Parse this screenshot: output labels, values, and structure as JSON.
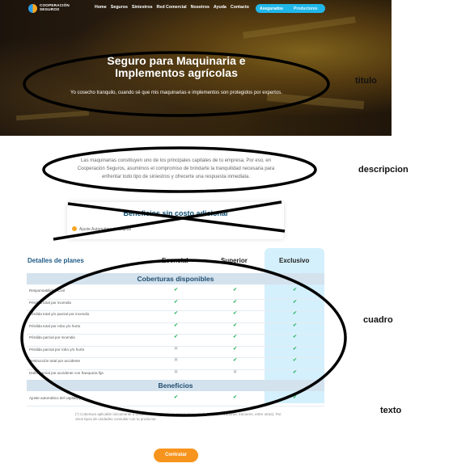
{
  "header": {
    "logo_line1": "COOPERACIÓN",
    "logo_line2": "SEGUROS",
    "nav": [
      "Home",
      "Seguros",
      "Siniestros",
      "Red Comercial",
      "Nosotros",
      "Ayuda",
      "Contacto"
    ],
    "pill_left": "Asegurados",
    "pill_right": "Productores"
  },
  "hero": {
    "title": "Seguro para Maquinaria e Implementos agrícolas",
    "subtitle": "Yo cosecho tranquilo, cuando sé que mis maquinarias e implementos son protegidos por expertos."
  },
  "annotations": {
    "titulo": "titulo",
    "descripcion": "descripcion",
    "cuadro": "cuadro",
    "texto": "texto"
  },
  "description": "Las maquinarias constituyen uno de los principales capitales de tu empresa. Por eso, en Cooperación Seguros, asumimos el compromiso de brindarte la tranquilidad necesaria para enfrentar todo tipo de siniestros y ofrecerte una respuesta inmediata.",
  "benefits_card": {
    "title": "Beneficios sin costo adicional",
    "item": "Ajuste Automático de Capital"
  },
  "plans": {
    "header_label": "Detalles de planes",
    "plan_names": [
      "Esencial",
      "Superior",
      "Exclusivo"
    ],
    "coverage_title": "Coberturas disponibles",
    "coverage_rows": [
      {
        "label": "Responsabilidad Civil",
        "marks": [
          "check",
          "check",
          "check"
        ]
      },
      {
        "label": "Pérdida total por incendio",
        "marks": [
          "check",
          "check",
          "check"
        ]
      },
      {
        "label": "Pérdida total y/o parcial por incendio",
        "marks": [
          "check",
          "check",
          "check"
        ]
      },
      {
        "label": "Pérdida total por robo y/o hurto",
        "marks": [
          "check",
          "check",
          "check"
        ]
      },
      {
        "label": "Pérdida parcial por incendio",
        "marks": [
          "check",
          "check",
          "check"
        ]
      },
      {
        "label": "Pérdida parcial por robo y/o hurto",
        "marks": [
          "cross",
          "check",
          "check"
        ]
      },
      {
        "label": "Destrucción total por accidente",
        "marks": [
          "cross",
          "check",
          "check"
        ]
      },
      {
        "label": "Daño parcial por accidente con franquicia fija",
        "marks": [
          "cross",
          "cross",
          "check"
        ]
      }
    ],
    "benefits_title": "Beneficios",
    "benefit_rows": [
      {
        "label": "Ajuste automático del capital(*)",
        "marks": [
          "check",
          "check",
          "check"
        ]
      }
    ],
    "footnote": "(*) Cobertura aplicable únicamente a unidades con propulsión propia (cosechadoras, pulverizadoras, tractores, entre otras). Por otros tipos de unidades consultar con tu productor."
  },
  "cta_label": "Contratar",
  "colors": {
    "accent_blue": "#20b6e8",
    "brand_orange": "#f7941d",
    "check_green": "#2fb565",
    "band_blue": "#d4e2ee",
    "exclusive_col": "#d4f0fc",
    "heading_navy": "#1f4d6e"
  }
}
